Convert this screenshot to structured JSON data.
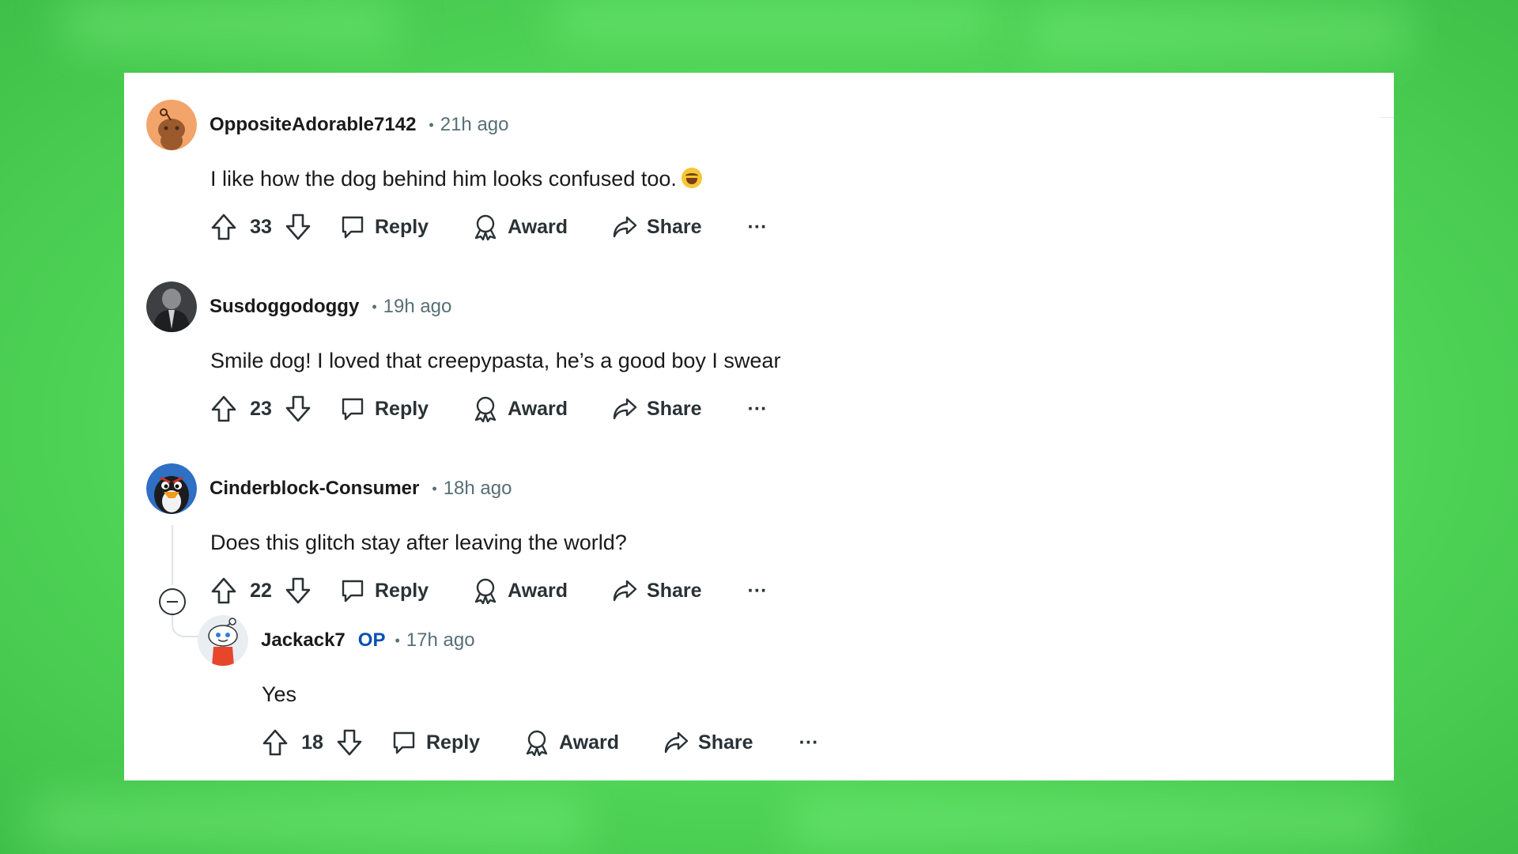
{
  "comments": [
    {
      "username": "OppositeAdorable7142",
      "separator": "•",
      "time": "21h ago",
      "body": "I like how the dog behind him looks confused too.",
      "body_emoji": "joy-emoji",
      "score": "33",
      "reply_label": "Reply",
      "award_label": "Award",
      "share_label": "Share",
      "more_label": "···",
      "avatar_color": "#f3a46a"
    },
    {
      "username": "Susdoggodoggy",
      "separator": "•",
      "time": "19h ago",
      "body": "Smile dog! I loved that creepypasta, he’s a good boy I swear",
      "score": "23",
      "reply_label": "Reply",
      "award_label": "Award",
      "share_label": "Share",
      "more_label": "···",
      "avatar_color": "#3d3f42"
    },
    {
      "username": "Cinderblock-Consumer",
      "separator": "•",
      "time": "18h ago",
      "body": "Does this glitch stay after leaving the world?",
      "score": "22",
      "reply_label": "Reply",
      "award_label": "Award",
      "share_label": "Share",
      "more_label": "···",
      "avatar_color": "#2f6fc4"
    },
    {
      "username": "Jackack7",
      "op_tag": "OP",
      "separator": "•",
      "time": "17h ago",
      "body": "Yes",
      "score": "18",
      "reply_label": "Reply",
      "award_label": "Award",
      "share_label": "Share",
      "more_label": "···",
      "avatar_color": "#e9eef2"
    }
  ],
  "colors": {
    "background_green": "#6fea74",
    "card": "#ffffff",
    "text": "#1a1a1b",
    "meta": "#576f76",
    "op": "#0a4fb3"
  }
}
